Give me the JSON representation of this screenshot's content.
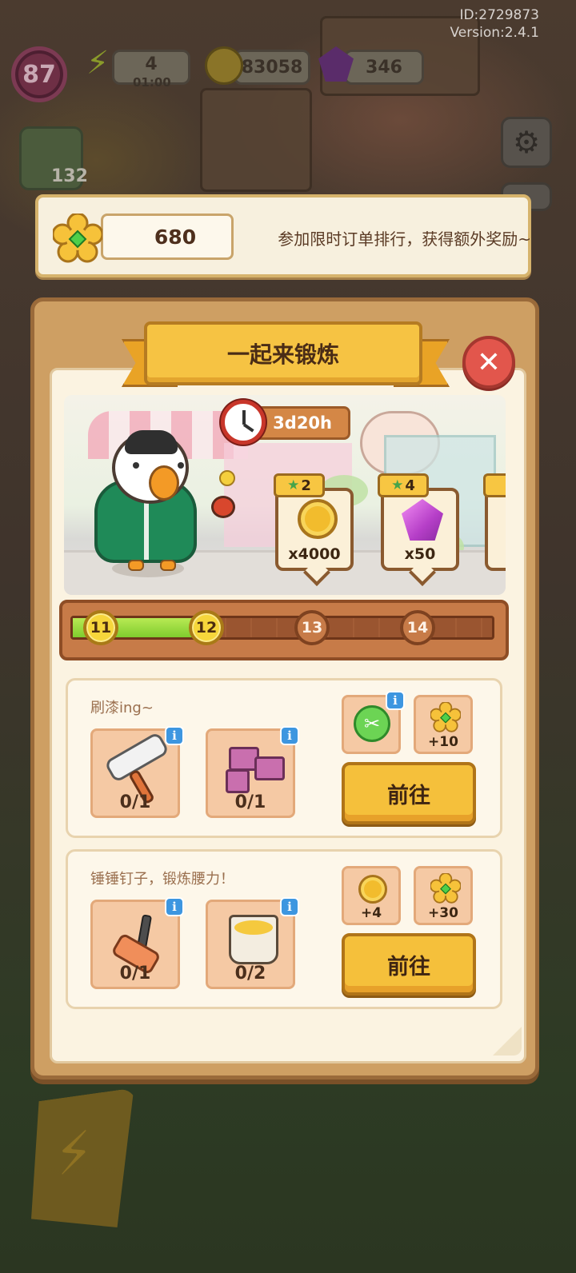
{
  "corner_info": {
    "id": "ID:2729873",
    "version": "Version:2.4.1"
  },
  "hud": {
    "level": "87",
    "energy": "4",
    "energy_timer": "01:00",
    "coins": "83058",
    "gems": "346",
    "side_item_count": "132"
  },
  "banner": {
    "flower_count": "680",
    "text": "参加限时订单排行，获得额外奖励~"
  },
  "panel": {
    "title": "一起来锻炼",
    "timer": "3d20h",
    "rewards": [
      {
        "stars": "2",
        "amount": "x4000",
        "type": "coin"
      },
      {
        "stars": "4",
        "amount": "x50",
        "type": "gem"
      }
    ],
    "progress": {
      "levels": [
        "11",
        "12",
        "13",
        "14"
      ],
      "reached": 2,
      "fill_fraction": 0.33
    }
  },
  "tasks": [
    {
      "title": "刷漆ing~",
      "items": [
        {
          "icon": "paint-roller-icon",
          "count": "0/1"
        },
        {
          "icon": "bricks-icon",
          "count": "0/1"
        }
      ],
      "rewards": [
        {
          "icon": "green-token-icon",
          "label": ""
        },
        {
          "icon": "flower-icon",
          "label": "+10"
        }
      ],
      "button": "前往"
    },
    {
      "title": "锤锤钉子，锻炼腰力！",
      "items": [
        {
          "icon": "hammer-icon",
          "count": "0/1"
        },
        {
          "icon": "paint-bucket-icon",
          "count": "0/2"
        }
      ],
      "rewards": [
        {
          "icon": "coin-icon",
          "label": "+4"
        },
        {
          "icon": "flower-icon",
          "label": "+30"
        }
      ],
      "button": "前往"
    }
  ],
  "colors": {
    "panel": "#ce9f63",
    "title_plate": "#f6c343",
    "close": "#e2564c",
    "progress_fill": "#7fcc2e",
    "button": "#f5c03b"
  }
}
